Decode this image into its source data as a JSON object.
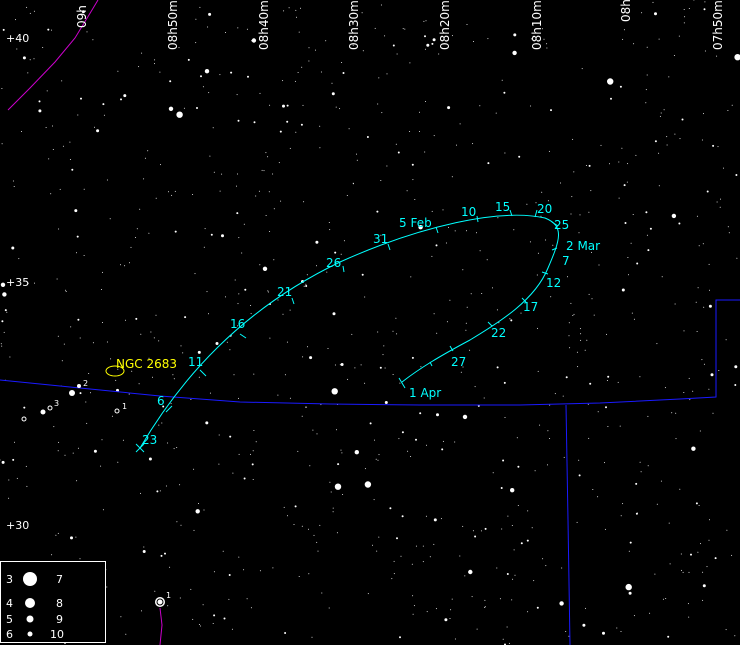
{
  "ra_labels": [
    "09h",
    "08h50m",
    "08h40m",
    "08h30m",
    "08h20m",
    "08h10m",
    "08h",
    "07h50m"
  ],
  "dec_labels": [
    "+40",
    "+35",
    "+30"
  ],
  "path_dates": [
    "23",
    "6",
    "11",
    "16",
    "21",
    "26",
    "31",
    "5 Feb",
    "10",
    "15",
    "20",
    "25",
    "2 Mar",
    "7",
    "12",
    "17",
    "22",
    "27",
    "1 Apr"
  ],
  "object_label": "NGC 2683",
  "star_magnitude_labels": [
    "2",
    "3",
    "1",
    "1",
    "1"
  ],
  "legend": {
    "magnitudes": [
      "3",
      "4",
      "5",
      "6",
      "7",
      "8",
      "9",
      "10"
    ]
  },
  "colors": {
    "background": "#000000",
    "path": "#00ffff",
    "object": "#ffff00",
    "boundary": "#0000aa",
    "ecliptic": "#cc00cc"
  }
}
